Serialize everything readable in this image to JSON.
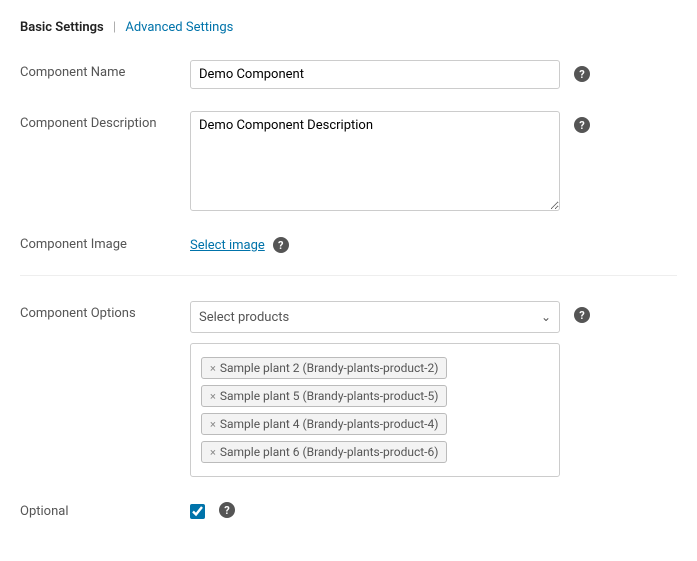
{
  "tabs": {
    "basic": "Basic Settings",
    "advanced": "Advanced Settings"
  },
  "labels": {
    "name": "Component Name",
    "desc": "Component Description",
    "image": "Component Image",
    "options": "Component Options",
    "optional": "Optional"
  },
  "values": {
    "name": "Demo Component",
    "desc": "Demo Component Description",
    "imageLink": "Select image",
    "optionsPlaceholder": "Select products",
    "optionalChecked": true
  },
  "selected": [
    "Sample plant 2 (Brandy-plants-product-2)",
    "Sample plant 5 (Brandy-plants-product-5)",
    "Sample plant 4 (Brandy-plants-product-4)",
    "Sample plant 6 (Brandy-plants-product-6)"
  ]
}
